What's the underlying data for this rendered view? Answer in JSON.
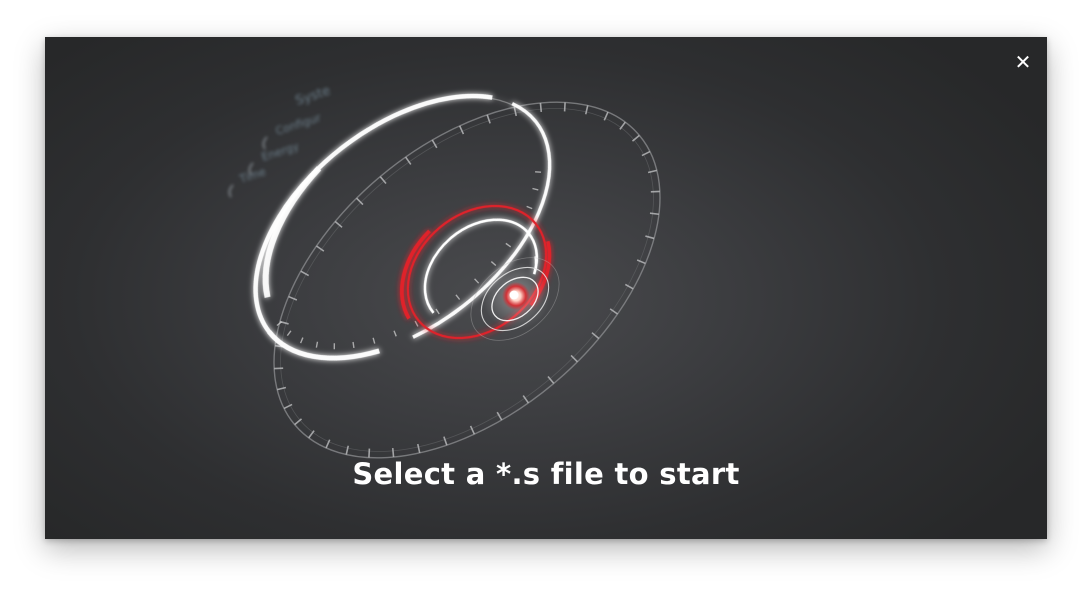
{
  "dialog": {
    "close_label": "✕",
    "prompt": "Select a *.s file to start"
  },
  "artwork": {
    "hud_labels": [
      "Energy",
      "Time"
    ],
    "colors": {
      "ring": "#ffffff",
      "accent": "#e0242a",
      "dial": "#9a9b9e",
      "label": "#7f97a6"
    }
  }
}
